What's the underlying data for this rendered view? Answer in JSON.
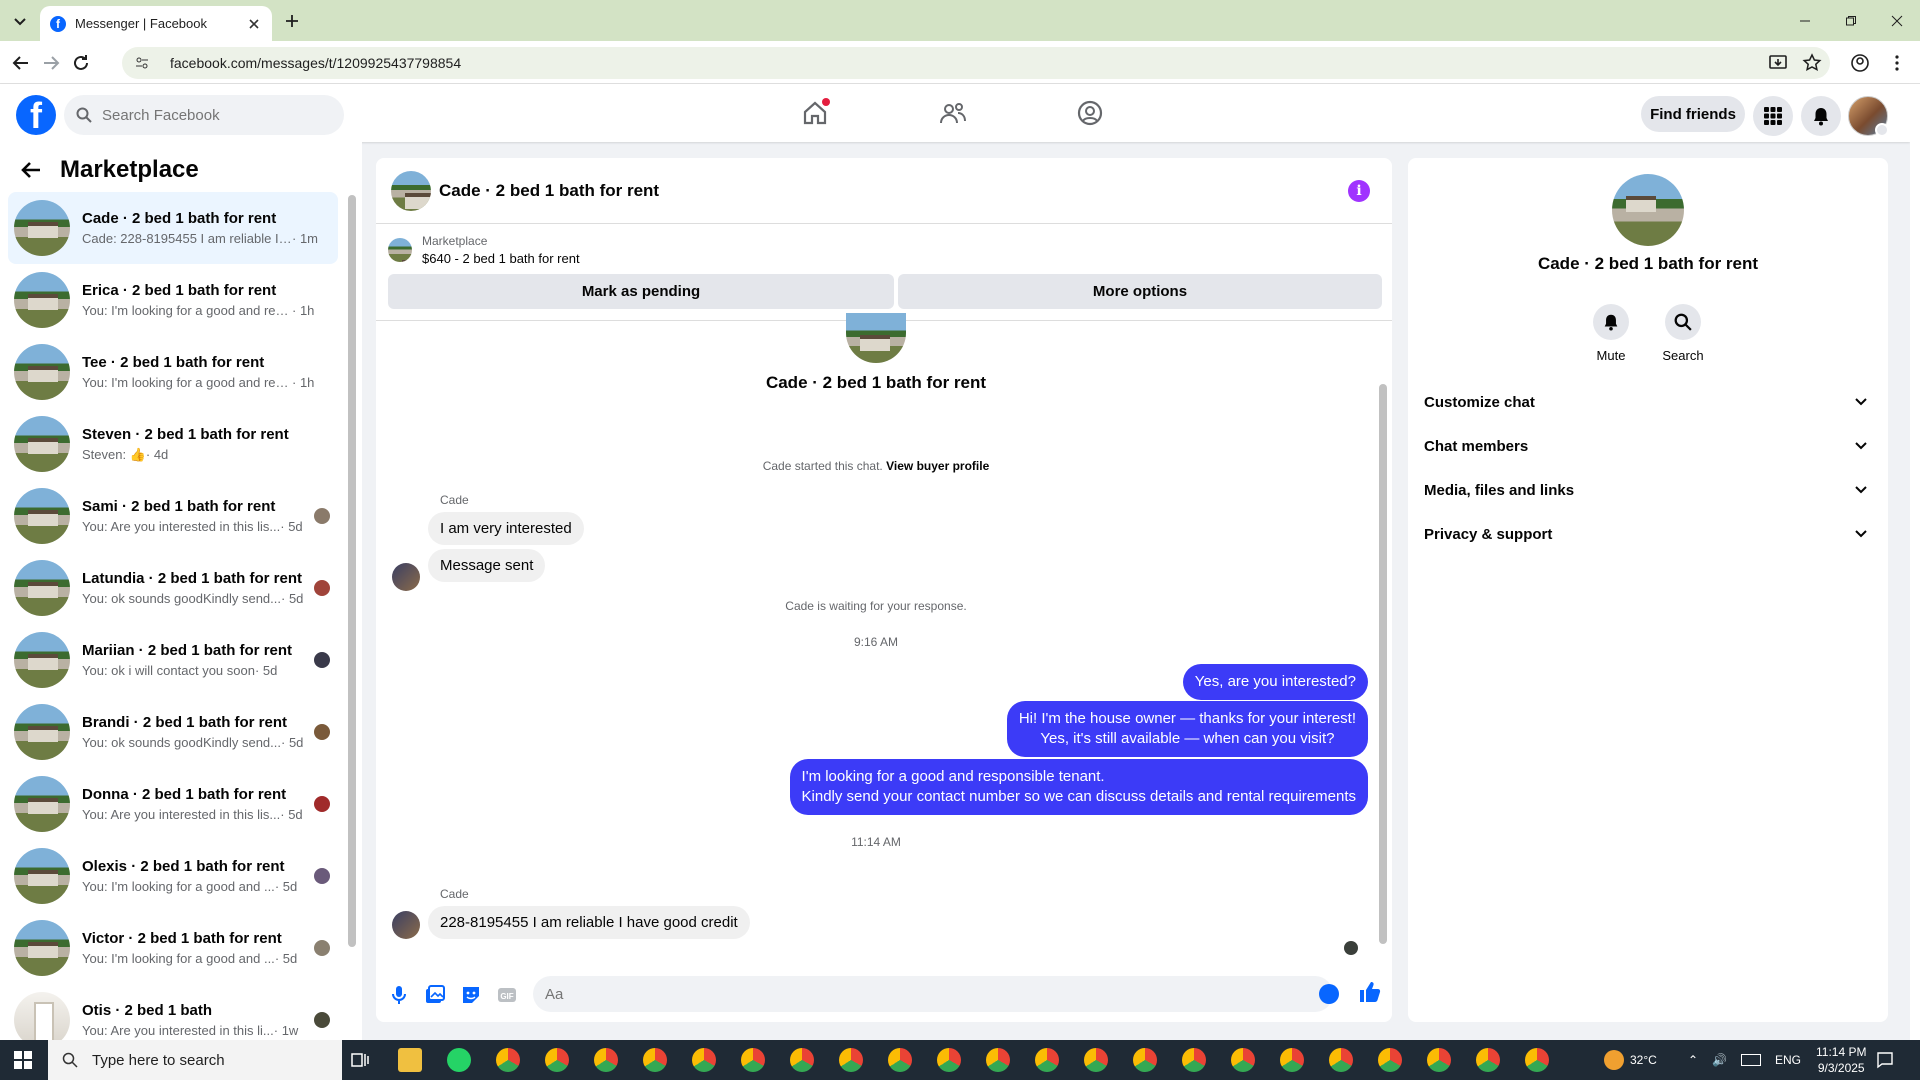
{
  "browser": {
    "tab_title": "Messenger | Facebook",
    "url": "facebook.com/messages/t/1209925437798854"
  },
  "fb": {
    "search_placeholder": "Search Facebook",
    "find_friends": "Find friends"
  },
  "sidebar": {
    "title": "Marketplace",
    "conversations": [
      {
        "name": "Cade · 2 bed 1 bath for rent",
        "preview": "Cade: 228-8195455 I am reliable I ...",
        "time": "· 1m",
        "selected": true
      },
      {
        "name": "Erica · 2 bed 1 bath for rent",
        "preview": "You: I'm looking for a good and res...",
        "time": "· 1h"
      },
      {
        "name": "Tee · 2 bed 1 bath for rent",
        "preview": "You: I'm looking for a good and res...",
        "time": "· 1h"
      },
      {
        "name": "Steven · 2 bed 1 bath for rent",
        "preview": "Steven: 👍",
        "time": "· 4d"
      },
      {
        "name": "Sami · 2 bed 1 bath for rent",
        "preview": "You: Are you interested in this lis...",
        "time": "· 5d"
      },
      {
        "name": "Latundia · 2 bed 1 bath for rent",
        "preview": "You: ok sounds goodKindly send...",
        "time": "· 5d"
      },
      {
        "name": "Mariian · 2 bed 1 bath for rent",
        "preview": "You: ok i will contact you soon",
        "time": "· 5d"
      },
      {
        "name": "Brandi · 2 bed 1 bath for rent",
        "preview": "You: ok sounds goodKindly send...",
        "time": "· 5d"
      },
      {
        "name": "Donna · 2 bed 1 bath for rent",
        "preview": "You: Are you interested in this lis...",
        "time": "· 5d"
      },
      {
        "name": "Olexis · 2 bed 1 bath for rent",
        "preview": "You: I'm looking for a good and ...",
        "time": "· 5d"
      },
      {
        "name": "Victor · 2 bed 1 bath for rent",
        "preview": "You: I'm looking for a good and ...",
        "time": "· 5d"
      },
      {
        "name": "Otis · 2 bed 1 bath",
        "preview": "You: Are you interested in this li...",
        "time": "· 1w"
      }
    ]
  },
  "chat": {
    "title": "Cade · 2 bed 1 bath for rent",
    "listing_label": "Marketplace",
    "listing_item": "$640 - 2 bed 1 bath for rent",
    "mark_pending": "Mark as pending",
    "more_options": "More options",
    "thread_name": "Cade · 2 bed 1 bath for rent",
    "started_text": "Cade started this chat.",
    "view_profile": "View buyer profile",
    "sender": "Cade",
    "msg_in_1": "I am very interested",
    "msg_in_2": "Message sent",
    "waiting": "Cade is waiting for your response.",
    "time_1": "9:16 AM",
    "msg_out_1": "Yes, are you interested?",
    "msg_out_2a": "Hi! I'm the house owner — thanks for your interest!",
    "msg_out_2b": "Yes, it's still available — when can you visit?",
    "msg_out_3a": "I'm looking for a good and responsible tenant.",
    "msg_out_3b": "Kindly send your contact number so we can discuss details and rental requirements",
    "time_2": "11:14 AM",
    "msg_in_3": "228-8195455 I am reliable I have good credit",
    "composer_placeholder": "Aa"
  },
  "panel": {
    "name": "Cade · 2 bed 1 bath for rent",
    "mute": "Mute",
    "search": "Search",
    "sections": [
      "Customize chat",
      "Chat members",
      "Media, files and links",
      "Privacy & support"
    ]
  },
  "taskbar": {
    "search_placeholder": "Type here to search",
    "temp": "32°C",
    "lang": "ENG",
    "time": "11:14 PM",
    "date": "9/3/2025"
  },
  "colors": {
    "brand": "#0866ff",
    "bubble_out": "#3c3bf7",
    "info": "#a033ff"
  }
}
